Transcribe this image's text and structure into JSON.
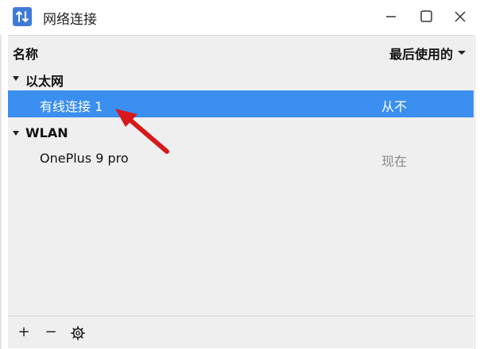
{
  "window": {
    "title": "网络连接"
  },
  "header": {
    "name_label": "名称",
    "last_used_label": "最后使用的"
  },
  "groups": [
    {
      "label": "以太网",
      "items": [
        {
          "name": "有线连接 1",
          "last_used": "从不",
          "selected": true
        }
      ]
    },
    {
      "label": "WLAN",
      "items": [
        {
          "name": "OnePlus 9 pro",
          "last_used": "现在",
          "selected": false
        }
      ]
    }
  ],
  "toolbar": {
    "add_label": "+",
    "remove_label": "−"
  },
  "colors": {
    "accent": "#3b8ff0",
    "app_icon": "#3f7ad6",
    "annotation_arrow": "#d7191c"
  },
  "icons": [
    "network-updown-icon",
    "minimize-icon",
    "maximize-icon",
    "close-icon",
    "gear-icon",
    "expander-triangle-icon",
    "sort-caret-icon",
    "annotation-arrow"
  ]
}
